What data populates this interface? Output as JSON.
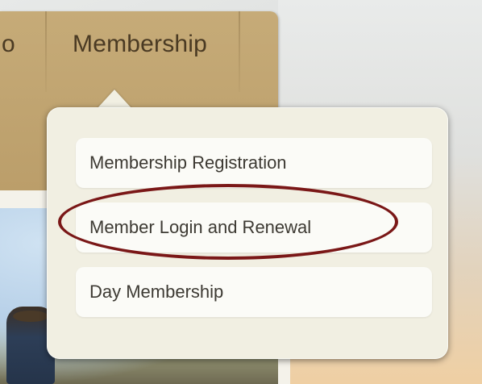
{
  "nav": {
    "items": [
      {
        "label": "o"
      },
      {
        "label": "Membership"
      }
    ]
  },
  "dropdown": {
    "items": [
      {
        "label": "Membership Registration"
      },
      {
        "label": "Member Login and Renewal",
        "highlighted": true
      },
      {
        "label": "Day Membership"
      }
    ]
  },
  "annotation": {
    "shape": "ellipse",
    "color": "#7a1717",
    "target": "Member Login and Renewal"
  },
  "colors": {
    "navbar": "#c2a672",
    "nav_text": "#4a3a23",
    "dropdown_bg": "#f1efe2",
    "menu_item_bg": "#fbfbf7"
  }
}
